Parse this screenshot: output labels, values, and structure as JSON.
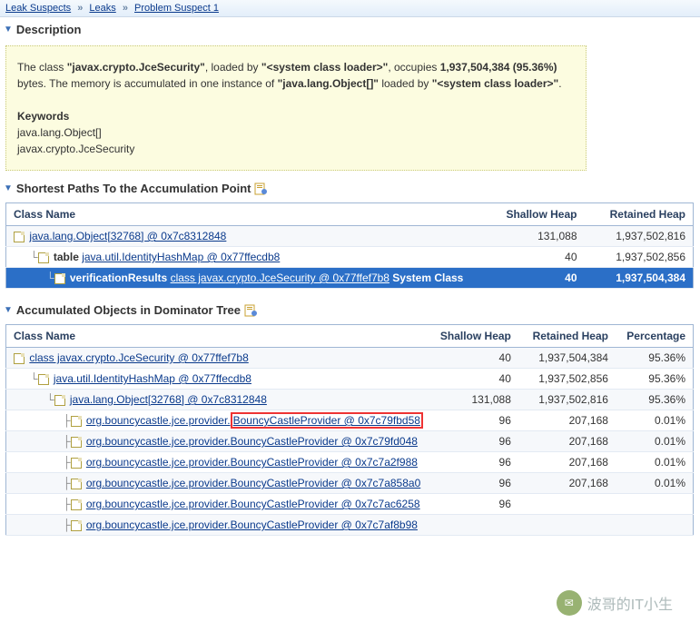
{
  "breadcrumb": {
    "items": [
      "Leak Suspects",
      "Leaks",
      "Problem Suspect 1"
    ]
  },
  "sections": {
    "description": "Description",
    "shortest": "Shortest Paths To the Accumulation Point",
    "accumulated": "Accumulated Objects in Dominator Tree"
  },
  "desc": {
    "p1a": "The class ",
    "p1b": "\"javax.crypto.JceSecurity\"",
    "p1c": ", loaded by ",
    "p1d": "\"<system class loader>\"",
    "p1e": ", occupies ",
    "p1f": "1,937,504,384 (95.36%)",
    "p1g": " bytes. The memory is accumulated in one instance of ",
    "p1h": "\"java.lang.Object[]\"",
    "p1i": " loaded by ",
    "p1j": "\"<system class loader>\"",
    "p1k": ".",
    "kw_label": "Keywords",
    "kw1": "java.lang.Object[]",
    "kw2": "javax.crypto.JceSecurity"
  },
  "table1": {
    "headers": {
      "name": "Class Name",
      "shallow": "Shallow Heap",
      "retained": "Retained Heap"
    },
    "rows": [
      {
        "link": "java.lang.Object[32768] @ 0x7c8312848",
        "shallow": "131,088",
        "retained": "1,937,502,816"
      },
      {
        "prefix": "table ",
        "link": "java.util.IdentityHashMap @ 0x77ffecdb8",
        "shallow": "40",
        "retained": "1,937,502,856"
      },
      {
        "prefix": "verificationResults ",
        "link": "class javax.crypto.JceSecurity @ 0x77ffef7b8",
        "suffix": " System Class",
        "shallow": "40",
        "retained": "1,937,504,384",
        "selected": true
      }
    ]
  },
  "table2": {
    "headers": {
      "name": "Class Name",
      "shallow": "Shallow Heap",
      "retained": "Retained Heap",
      "pct": "Percentage"
    },
    "rows": [
      {
        "ind": 0,
        "link": "class javax.crypto.JceSecurity @ 0x77ffef7b8",
        "shallow": "40",
        "retained": "1,937,504,384",
        "pct": "95.36%"
      },
      {
        "ind": 1,
        "link": "java.util.IdentityHashMap @ 0x77ffecdb8",
        "shallow": "40",
        "retained": "1,937,502,856",
        "pct": "95.36%",
        "white": true
      },
      {
        "ind": 2,
        "link": "java.lang.Object[32768] @ 0x7c8312848",
        "shallow": "131,088",
        "retained": "1,937,502,816",
        "pct": "95.36%"
      },
      {
        "ind": 3,
        "link_pre": "org.bouncycastle.jce.provider.",
        "link_red": "BouncyCastleProvider @ 0x7c79fbd58",
        "shallow": "96",
        "retained": "207,168",
        "pct": "0.01%",
        "white": true
      },
      {
        "ind": 3,
        "link": "org.bouncycastle.jce.provider.BouncyCastleProvider @ 0x7c79fd048",
        "shallow": "96",
        "retained": "207,168",
        "pct": "0.01%"
      },
      {
        "ind": 3,
        "link": "org.bouncycastle.jce.provider.BouncyCastleProvider @ 0x7c7a2f988",
        "shallow": "96",
        "retained": "207,168",
        "pct": "0.01%",
        "white": true
      },
      {
        "ind": 3,
        "link": "org.bouncycastle.jce.provider.BouncyCastleProvider @ 0x7c7a858a0",
        "shallow": "96",
        "retained": "207,168",
        "pct": "0.01%"
      },
      {
        "ind": 3,
        "link": "org.bouncycastle.jce.provider.BouncyCastleProvider @ 0x7c7ac6258",
        "shallow": "96",
        "retained": "",
        "pct": "",
        "white": true
      },
      {
        "ind": 3,
        "link": "org.bouncycastle.jce.provider.BouncyCastleProvider @ 0x7c7af8b98",
        "shallow": "",
        "retained": "",
        "pct": ""
      }
    ]
  },
  "watermark": {
    "label": "波哥的IT小生"
  }
}
